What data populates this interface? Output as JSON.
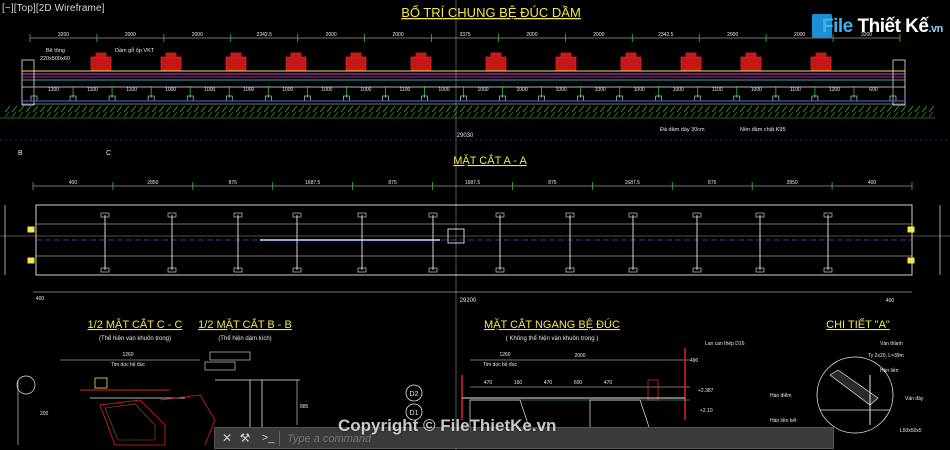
{
  "viewport": {
    "label": "[−][Top][2D Wireframe]"
  },
  "logo": {
    "brand_left": "File",
    "brand_right": "Thiết Kế",
    "tld": ".vn"
  },
  "command_line": {
    "placeholder": "Type a command",
    "close_glyph": "✕",
    "tool_glyph": "⚒",
    "prompt_glyph": ">_"
  },
  "watermark": "Copyright © FileThietKe.vn",
  "drawing": {
    "title_main": "BỐ TRÍ CHUNG BỆ ĐÚC DẦM",
    "title_section_aa": "MẶT CẮT A - A",
    "title_half_cc": "1/2 MẶT CẮT C - C",
    "title_half_bb": "1/2 MẶT CẮT B - B",
    "title_cross": "MẶT CẮT NGANG BỆ ĐÚC",
    "title_detail": "CHI TIẾT \"A\"",
    "note_cc": "(Thể hiện ván khuôn trong)",
    "note_bb": "(Thể hiện dàm kích)",
    "note_cross": "( Không thể hiện ván khuôn trong )",
    "label_bedong": "Bê tông",
    "label_bedong_size": "220x500x60",
    "label_dam": "Dầm gỗ ốp VKT",
    "label_da": "Đá dăm dày 30cm",
    "label_nen": "Nền đầm chặt K95",
    "label_total": "29030",
    "label_total2": "29200",
    "section_b": "B",
    "section_c": "C",
    "top_dims": [
      "3200",
      "2000",
      "2000",
      "2342.5",
      "2000",
      "2000",
      "3375",
      "2000",
      "2000",
      "2342.5",
      "2000",
      "2000",
      "3200"
    ],
    "bottom_dims": [
      "1200",
      "1100",
      "1100",
      "1000",
      "1000",
      "1000",
      "1000",
      "1000",
      "1000",
      "1100",
      "1000",
      "1000",
      "1000",
      "1000",
      "1000",
      "1000",
      "1000",
      "1100",
      "1000",
      "1100",
      "1200",
      "600"
    ],
    "aa_dims": [
      "400",
      "2850",
      "875",
      "1687.5",
      "875",
      "1687.5",
      "875",
      "1687.5",
      "875",
      "2850",
      "400"
    ],
    "d1": "D1",
    "d2": "D2",
    "detail_labels": [
      "Ván thành",
      "Ty 2x20, L=39m",
      "Hàn liền",
      "Hàn điểm",
      "Ván đáy",
      "Hàn liền kết",
      "L50x50x5"
    ],
    "cross_dims": [
      "1260",
      "470",
      "160",
      "470",
      "600",
      "470",
      "160",
      "2000",
      "490",
      "1260"
    ],
    "cross_labels": [
      "Tim dọc bệ đúc",
      "+2.387",
      "+2.10",
      "Lan can thép D16"
    ]
  },
  "colors": {
    "bg": "#000000",
    "yellow": "#f4e64b",
    "red": "#e52020",
    "cyan": "#4fd2e6",
    "green": "#3fbf3f",
    "magenta": "#d641d6",
    "white": "#e8e8e8",
    "blue": "#3a5ec7"
  }
}
